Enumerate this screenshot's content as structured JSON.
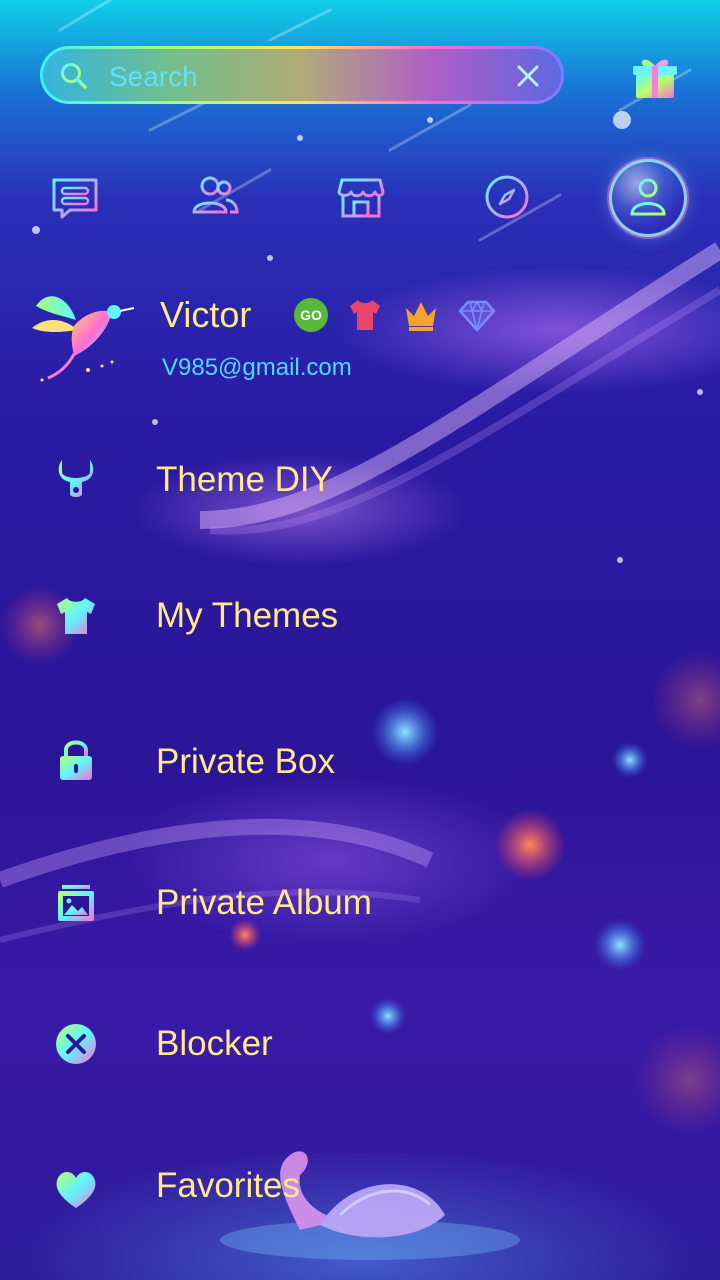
{
  "search": {
    "placeholder": "Search"
  },
  "nav": {
    "icons": [
      "messages-icon",
      "contacts-icon",
      "store-icon",
      "discover-icon",
      "profile-icon"
    ]
  },
  "profile": {
    "name": "Victor",
    "email": "V985@gmail.com",
    "badges": [
      "go-badge-icon",
      "theme-shirt-icon",
      "crown-icon",
      "diamond-icon"
    ]
  },
  "menu": {
    "items": [
      {
        "label": "Theme DIY",
        "icon": "wrench-icon"
      },
      {
        "label": "My Themes",
        "icon": "shirt-icon"
      },
      {
        "label": "Private Box",
        "icon": "lock-icon"
      },
      {
        "label": "Private Album",
        "icon": "album-icon"
      },
      {
        "label": "Blocker",
        "icon": "block-icon"
      },
      {
        "label": "Favorites",
        "icon": "heart-icon"
      }
    ]
  },
  "colors": {
    "label": "#ffe98a",
    "email": "#52d8ff",
    "search_text": "#5fe2ff",
    "go_badge": "#58b83a",
    "shirt_badge": "#e8456b",
    "crown_badge": "#f2a52a",
    "diamond_badge": "#7b8cff"
  }
}
